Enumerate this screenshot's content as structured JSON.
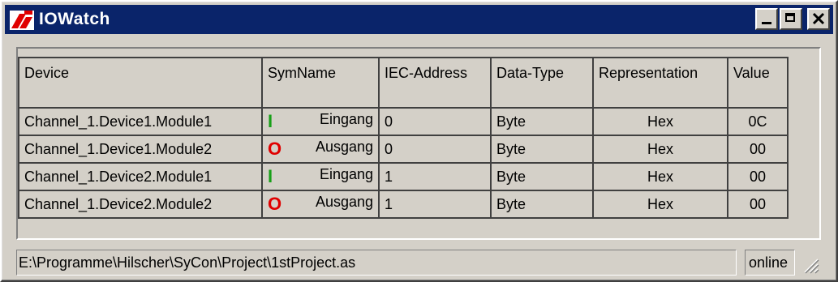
{
  "window": {
    "title": "IOWatch",
    "accent": "#0a246a"
  },
  "columns": [
    "Device",
    "SymName",
    "IEC-Address",
    "Data-Type",
    "Representation",
    "Value"
  ],
  "rows": [
    {
      "device": "Channel_1.Device1.Module1",
      "marker": "I",
      "marker_kind": "input",
      "sym": "Eingang",
      "iec": "0",
      "type": "Byte",
      "rep": "Hex",
      "value": "0C"
    },
    {
      "device": "Channel_1.Device1.Module2",
      "marker": "O",
      "marker_kind": "output",
      "sym": "Ausgang",
      "iec": "0",
      "type": "Byte",
      "rep": "Hex",
      "value": "00"
    },
    {
      "device": "Channel_1.Device2.Module1",
      "marker": "I",
      "marker_kind": "input",
      "sym": "Eingang",
      "iec": "1",
      "type": "Byte",
      "rep": "Hex",
      "value": "00"
    },
    {
      "device": "Channel_1.Device2.Module2",
      "marker": "O",
      "marker_kind": "output",
      "sym": "Ausgang",
      "iec": "1",
      "type": "Byte",
      "rep": "Hex",
      "value": "00"
    }
  ],
  "status": {
    "path": "E:\\Programme\\Hilscher\\SyCon\\Project\\1stProject.as",
    "state": "online"
  }
}
